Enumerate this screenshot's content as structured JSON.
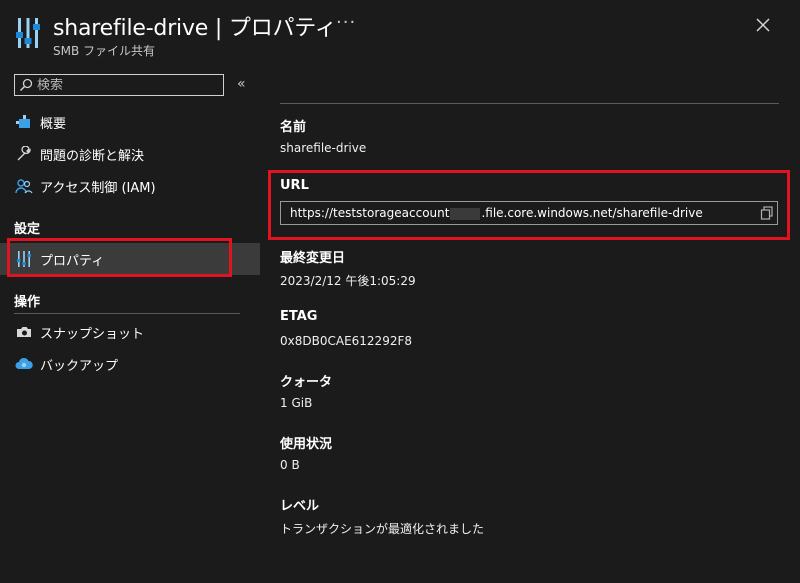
{
  "header": {
    "title": "sharefile-drive | プロパティ",
    "subtitle": "SMB ファイル共有",
    "more_label": "···",
    "icon": "properties-sliders-icon"
  },
  "search": {
    "placeholder": "検索",
    "value": ""
  },
  "nav": {
    "items": [
      {
        "label": "概要",
        "icon": "overview-icon"
      },
      {
        "label": "問題の診断と解決",
        "icon": "wrench-icon"
      },
      {
        "label": "アクセス制御 (IAM)",
        "icon": "people-icon"
      }
    ],
    "settings_section": "設定",
    "settings_items": [
      {
        "label": "プロパティ",
        "icon": "properties-icon",
        "active": true
      }
    ],
    "operations_section": "操作",
    "operations_items": [
      {
        "label": "スナップショット",
        "icon": "camera-icon"
      },
      {
        "label": "バックアップ",
        "icon": "cloud-backup-icon"
      }
    ]
  },
  "properties": {
    "name_label": "名前",
    "name_value": "sharefile-drive",
    "url_label": "URL",
    "url_prefix": "https://teststorageaccount",
    "url_suffix": ".file.core.windows.net/sharefile-drive",
    "modified_label": "最終変更日",
    "modified_value": "2023/2/12 午後1:05:29",
    "etag_label": "ETAG",
    "etag_value": "0x8DB0CAE612292F8",
    "quota_label": "クォータ",
    "quota_value": "1 GiB",
    "usage_label": "使用状況",
    "usage_value": "0 B",
    "tier_label": "レベル",
    "tier_value": "トランザクションが最適化されました"
  },
  "colors": {
    "background": "#1b1b1b",
    "highlight": "#e0141e",
    "accent": "#3ba0e6",
    "active_bg": "#3b3b3b"
  }
}
